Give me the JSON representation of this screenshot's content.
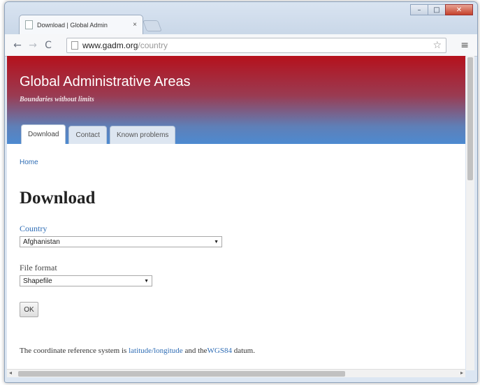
{
  "browser": {
    "tab_title": "Download | Global Admin",
    "tab_close": "×",
    "url_host": "www.gadm.org",
    "url_path": "/country",
    "back": "←",
    "forward": "→",
    "reload": "C",
    "star": "☆",
    "menu": "≡",
    "win_min": "–",
    "win_max": "□",
    "win_close": "✕"
  },
  "site": {
    "title": "Global Administrative Areas",
    "tagline": "Boundaries without limits",
    "tabs": [
      {
        "label": "Download",
        "active": true
      },
      {
        "label": "Contact",
        "active": false
      },
      {
        "label": "Known problems",
        "active": false
      }
    ]
  },
  "breadcrumb": "Home",
  "page_title": "Download",
  "form": {
    "country_label": "Country",
    "country_value": "Afghanistan",
    "format_label": "File format",
    "format_value": "Shapefile",
    "ok_label": "OK"
  },
  "footer_text": {
    "before": "The coordinate reference system is ",
    "link1": "latitude/longitude",
    "middle": " and the",
    "link2": "WGS84",
    "after": " datum."
  },
  "colors": {
    "header_top": "#b5111c",
    "header_bottom": "#4d8ad0",
    "link": "#2f6db5"
  }
}
